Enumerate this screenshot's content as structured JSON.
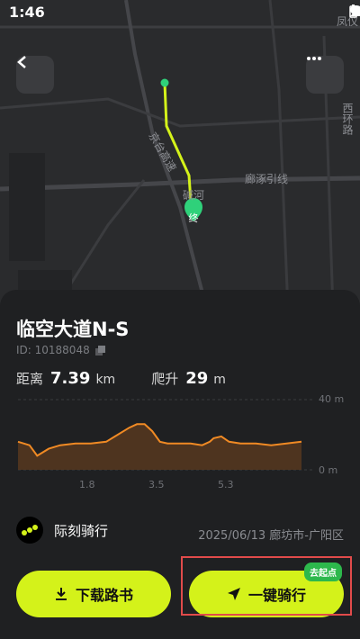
{
  "status": {
    "time": "1:46"
  },
  "map": {
    "labels": [
      {
        "text": "京台高速"
      },
      {
        "text": "廊涿引线"
      },
      {
        "text": "凤仪"
      },
      {
        "text": "西环路"
      },
      {
        "text": "碱河"
      }
    ],
    "end_marker": "终"
  },
  "route": {
    "title": "临空大道N-S",
    "id_text": "ID: 10188048",
    "distance_label": "距离",
    "distance_value": "7.39",
    "distance_unit": "km",
    "climb_label": "爬升",
    "climb_value": "29",
    "climb_unit": "m"
  },
  "chart_data": {
    "type": "area",
    "ylim": [
      0,
      40
    ],
    "yticks": [
      "40 m",
      "0 m"
    ],
    "xticks": [
      "1.8",
      "3.5",
      "5.3"
    ],
    "series": [
      {
        "x": [
          0,
          0.3,
          0.5,
          0.8,
          1.1,
          1.5,
          1.9,
          2.3,
          2.6,
          2.9,
          3.1,
          3.3,
          3.5,
          3.7,
          3.9,
          4.2,
          4.5,
          4.8,
          5.0,
          5.1,
          5.3,
          5.5,
          5.8,
          6.2,
          6.6,
          7.0,
          7.39
        ],
        "y": [
          16,
          14,
          8,
          12,
          14,
          15,
          15,
          16,
          20,
          24,
          26,
          26,
          22,
          16,
          15,
          15,
          15,
          14,
          16,
          18,
          19,
          16,
          15,
          15,
          14,
          15,
          16
        ]
      }
    ]
  },
  "owner": {
    "name": "际刻骑行"
  },
  "meta": "2025/06/13 廊坊市-广阳区",
  "buttons": {
    "download": "下载路书",
    "ride": "一键骑行",
    "badge": "去起点"
  }
}
